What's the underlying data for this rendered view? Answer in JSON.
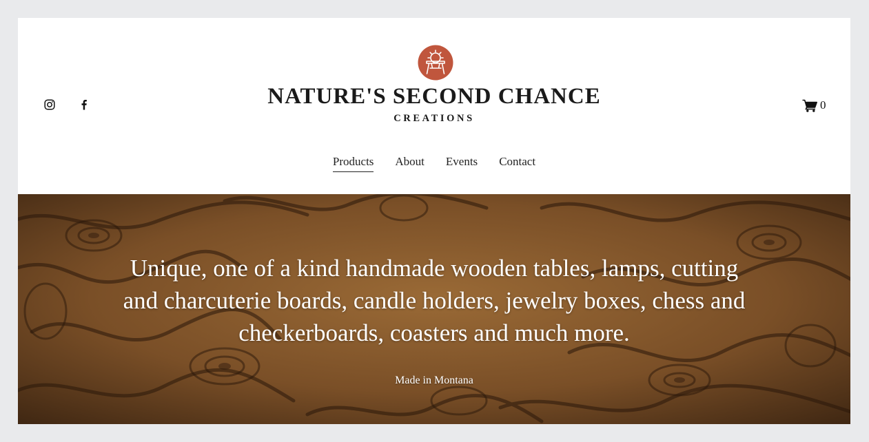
{
  "header": {
    "brand_title": "NATURE'S SECOND CHANCE",
    "brand_subtitle": "CREATIONS",
    "social": [
      {
        "icon": "instagram-icon"
      },
      {
        "icon": "facebook-icon"
      }
    ],
    "cart": {
      "icon": "cart-icon",
      "count": "0"
    },
    "logo": {
      "icon": "sawmill-logo-icon",
      "color": "#c0563d"
    }
  },
  "nav": {
    "items": [
      {
        "label": "Products",
        "active": true
      },
      {
        "label": "About",
        "active": false
      },
      {
        "label": "Events",
        "active": false
      },
      {
        "label": "Contact",
        "active": false
      }
    ]
  },
  "hero": {
    "heading": "Unique, one of a kind handmade wooden tables, lamps, cutting and charcuterie boards, candle holders, jewelry boxes, chess and checkerboards, coasters and much more.",
    "subheading": "Made in Montana",
    "background_color": "#6b4524"
  }
}
